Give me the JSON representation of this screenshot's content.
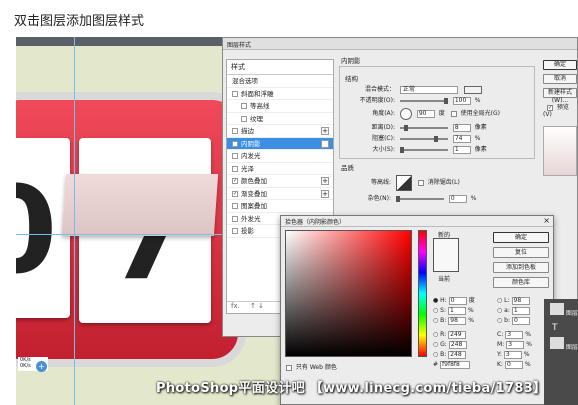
{
  "caption": "双击图层添加图层样式",
  "canvas": {
    "digits": [
      "0",
      "7"
    ],
    "badge_lines": [
      "0K/s",
      "0K/s"
    ],
    "badge_icon": "+"
  },
  "layer_style": {
    "title": "图层样式",
    "styles_header": "样式",
    "styles_list": [
      {
        "label": "混合选项",
        "checked": false,
        "indent": false,
        "plus": false,
        "selected": false,
        "box": false
      },
      {
        "label": "斜面和浮雕",
        "checked": false,
        "indent": false,
        "plus": false,
        "selected": false,
        "box": true
      },
      {
        "label": "等高线",
        "checked": false,
        "indent": true,
        "plus": false,
        "selected": false,
        "box": true
      },
      {
        "label": "纹理",
        "checked": false,
        "indent": true,
        "plus": false,
        "selected": false,
        "box": true
      },
      {
        "label": "描边",
        "checked": false,
        "indent": false,
        "plus": true,
        "selected": false,
        "box": true
      },
      {
        "label": "内阴影",
        "checked": true,
        "indent": false,
        "plus": true,
        "selected": true,
        "box": true
      },
      {
        "label": "内发光",
        "checked": false,
        "indent": false,
        "plus": false,
        "selected": false,
        "box": true
      },
      {
        "label": "光泽",
        "checked": false,
        "indent": false,
        "plus": false,
        "selected": false,
        "box": true
      },
      {
        "label": "颜色叠加",
        "checked": true,
        "indent": false,
        "plus": true,
        "selected": false,
        "box": true
      },
      {
        "label": "渐变叠加",
        "checked": true,
        "indent": false,
        "plus": true,
        "selected": false,
        "box": true
      },
      {
        "label": "图案叠加",
        "checked": false,
        "indent": false,
        "plus": false,
        "selected": false,
        "box": true
      },
      {
        "label": "外发光",
        "checked": false,
        "indent": false,
        "plus": false,
        "selected": false,
        "box": true
      },
      {
        "label": "投影",
        "checked": false,
        "indent": false,
        "plus": true,
        "selected": false,
        "box": true
      }
    ],
    "fx_label": "fx.",
    "fx_arrows": "↑ ↓",
    "inner_shadow": {
      "section_title": "内阴影",
      "structure_title": "结构",
      "blend_mode_label": "混合模式：",
      "blend_mode_value": "正常",
      "opacity_label": "不透明度(O):",
      "opacity_value": "100",
      "opacity_unit": "%",
      "angle_label": "角度(A):",
      "angle_value": "90",
      "angle_unit": "度",
      "global_light_label": "使用全局光(G)",
      "distance_label": "距离(D):",
      "distance_value": "8",
      "distance_unit": "像素",
      "choke_label": "阻塞(C):",
      "choke_value": "74",
      "choke_unit": "%",
      "size_label": "大小(S):",
      "size_value": "1",
      "size_unit": "像素",
      "quality_title": "品质",
      "contour_label": "等高线:",
      "antialias_label": "消除锯齿(L)",
      "noise_label": "杂色(N):",
      "noise_value": "0",
      "noise_unit": "%"
    },
    "buttons": {
      "ok": "确定",
      "cancel": "取消",
      "new_style": "新建样式(W)...",
      "preview": "预览(V)"
    }
  },
  "color_picker": {
    "title": "拾色器（内阴影颜色）",
    "close": "×",
    "new_label": "新的",
    "current_label": "当前",
    "buttons": {
      "ok": "确定",
      "reset": "复位",
      "add_swatch": "添加到色板",
      "libraries": "颜色库"
    },
    "web_only_label": "只有 Web 颜色",
    "values": {
      "H": "0",
      "H_unit": "度",
      "S": "1",
      "S_unit": "%",
      "B": "98",
      "B_unit": "%",
      "R": "249",
      "G": "248",
      "Bv": "248",
      "L": "98",
      "a": "1",
      "b": "0",
      "C": "3",
      "C_unit": "%",
      "M": "3",
      "M_unit": "%",
      "Y": "3",
      "Y_unit": "%",
      "K": "0",
      "K_unit": "%",
      "hex": "f9f8f8"
    },
    "new_color": "#f9f8f8"
  },
  "layers_panel": {
    "items": [
      "图层",
      "T",
      "图层"
    ]
  },
  "watermark": "PhotoShop平面设计吧 【www.linecg.com/tieba/1783】"
}
